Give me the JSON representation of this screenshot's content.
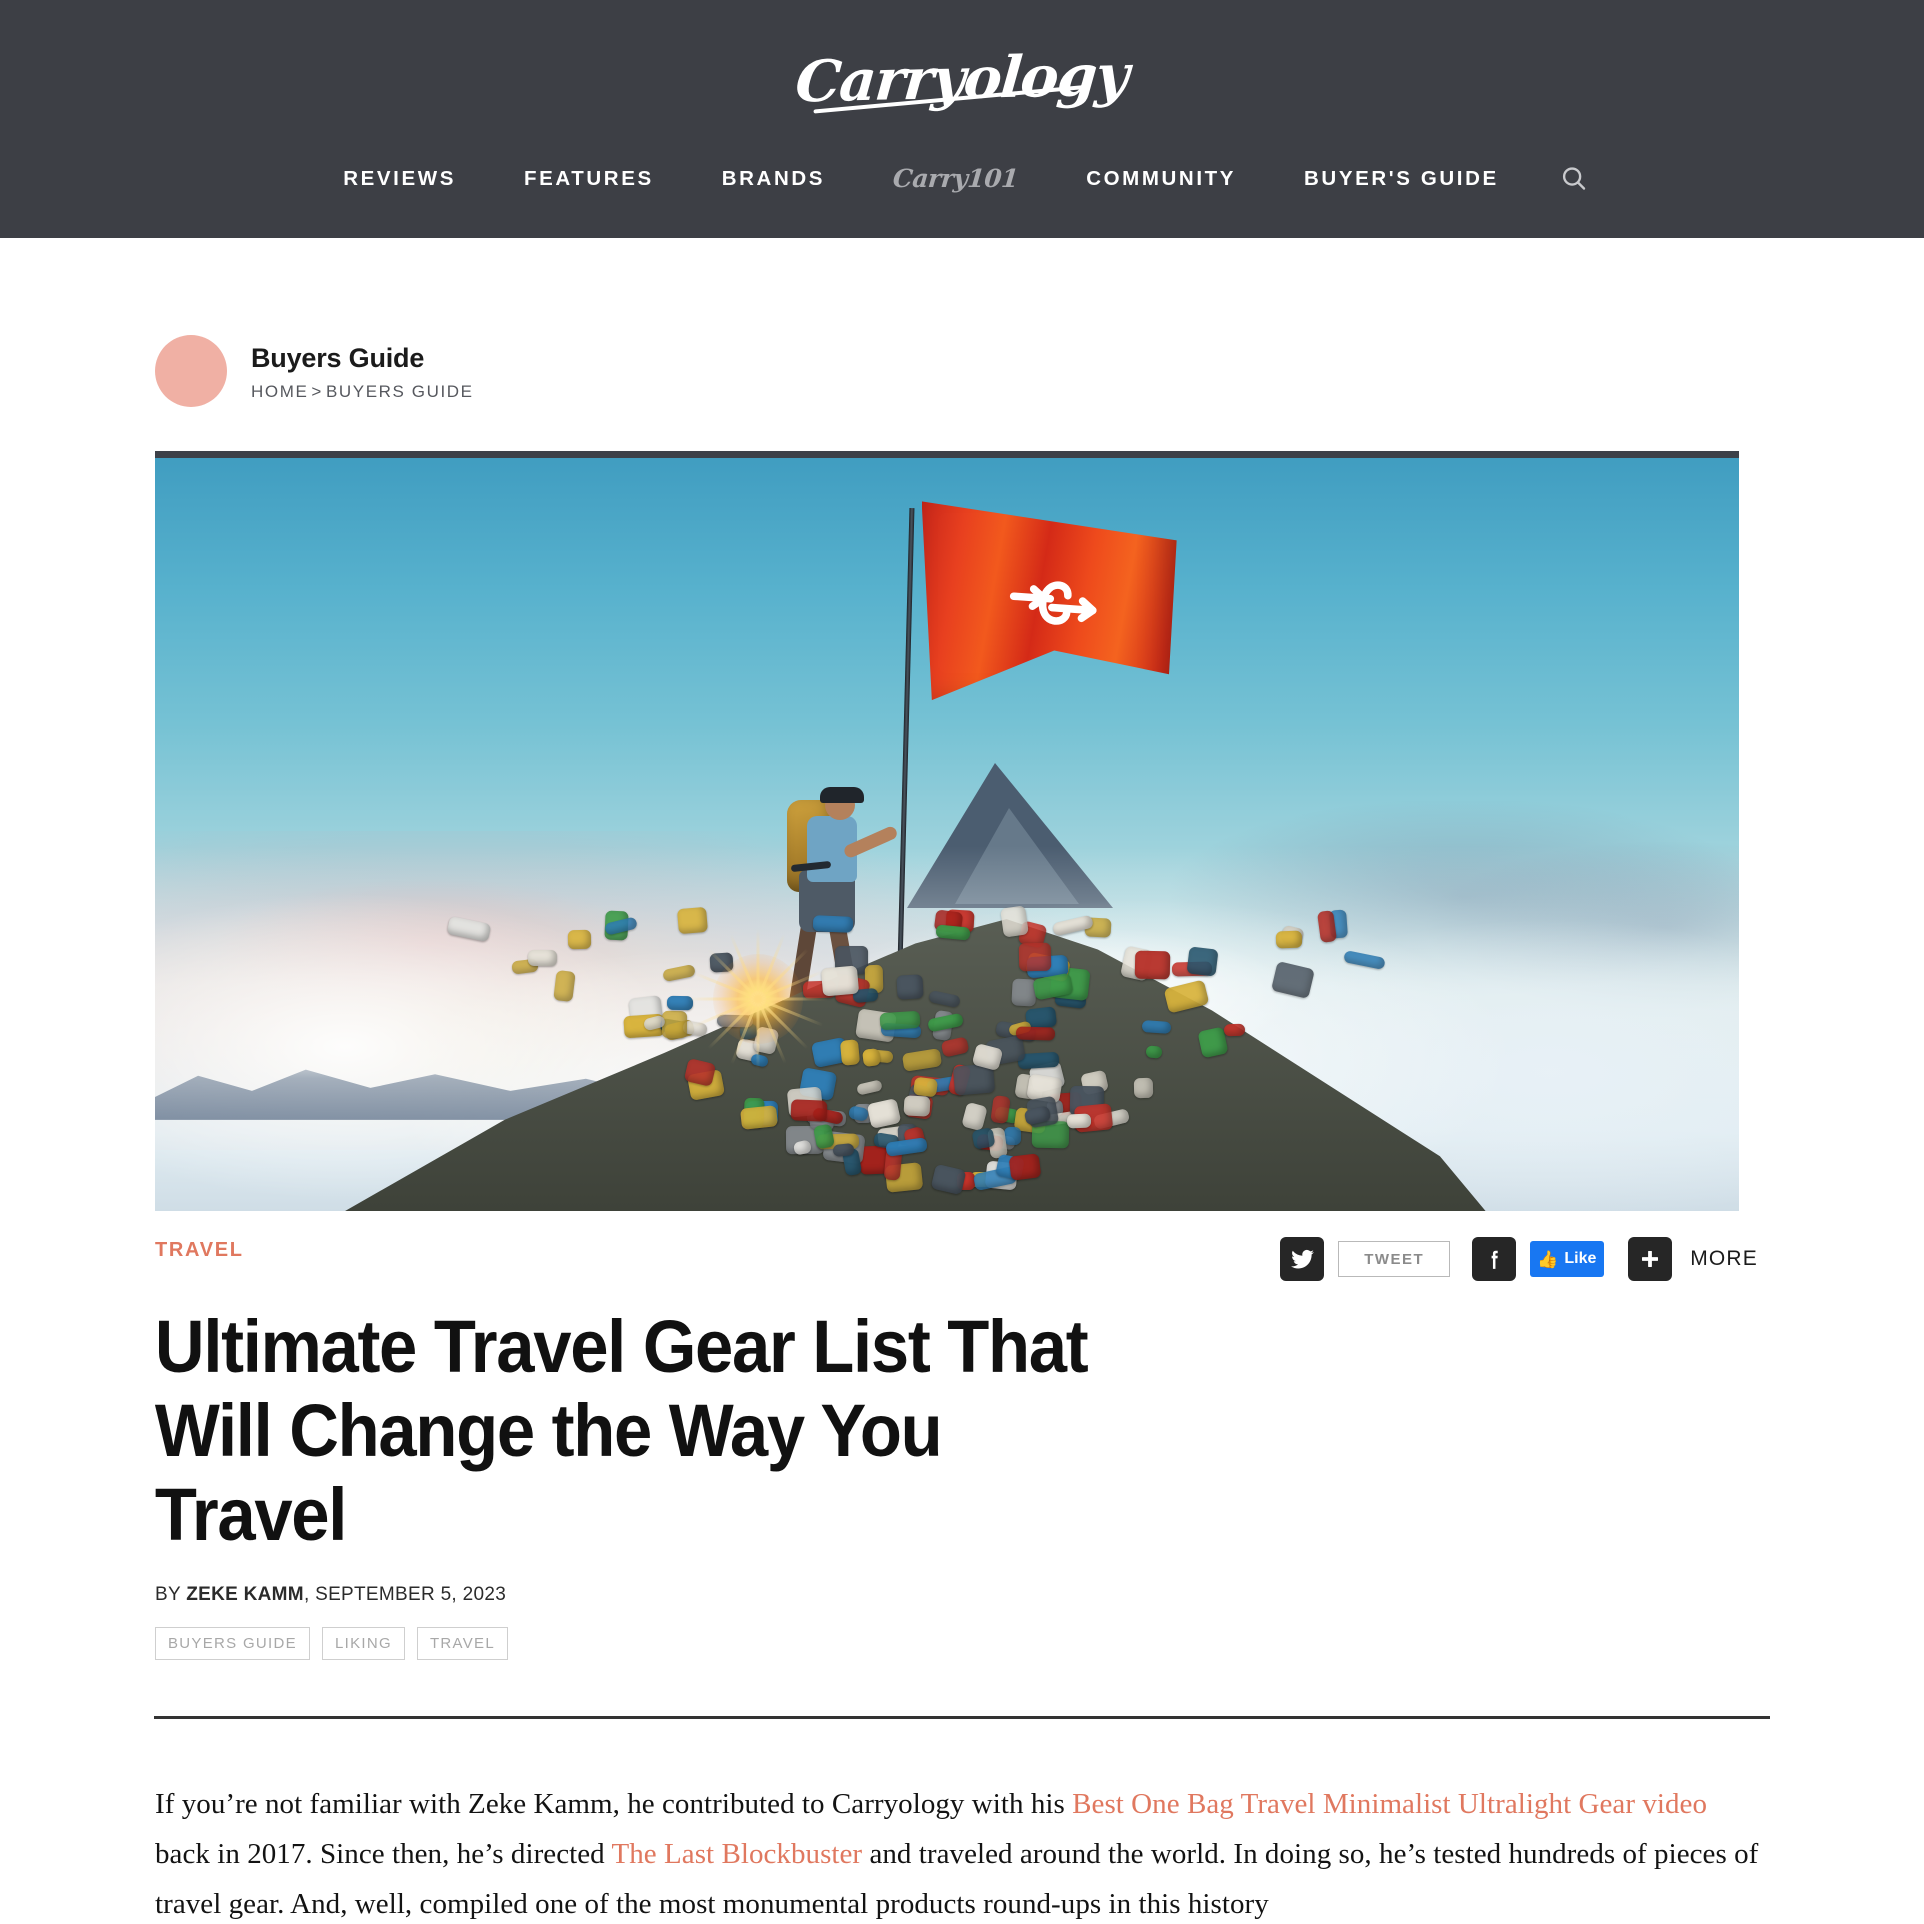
{
  "site": {
    "logo_text": "Carryology",
    "nav": [
      {
        "label": "REVIEWS",
        "style": "caps"
      },
      {
        "label": "FEATURES",
        "style": "caps"
      },
      {
        "label": "BRANDS",
        "style": "caps"
      },
      {
        "label": "Carry101",
        "style": "script"
      },
      {
        "label": "COMMUNITY",
        "style": "caps"
      },
      {
        "label": "BUYER'S GUIDE",
        "style": "caps"
      }
    ],
    "search_icon": "search-icon",
    "header_bg": "#3d3f45"
  },
  "breadcrumb": {
    "section_title": "Buyers Guide",
    "home": "HOME",
    "separator": ">",
    "current": "BUYERS GUIDE",
    "dot_color": "#f0b0a4"
  },
  "hero": {
    "alt": "Hiker standing on a mound of backpacks on a mountain summit holding a red Carryology flag above the clouds at sunset",
    "flag_color": "#e8401f",
    "sky_color": "#57b1cd"
  },
  "article": {
    "kicker": "TRAVEL",
    "kicker_color": "#e0785f",
    "title": "Ultimate Travel Gear List That Will Change the Way You Travel",
    "byline_prefix": "BY ",
    "author": "ZEKE KAMM",
    "byline_suffix": ", SEPTEMBER 5, 2023",
    "tags": [
      "BUYERS GUIDE",
      "LIKING",
      "TRAVEL"
    ],
    "body": {
      "p1_a": "If you’re not familiar with Zeke Kamm, he contributed to Carryology with his ",
      "link1": "Best One Bag Travel Minimalist Ultralight Gear video",
      "p1_b": " back in 2017. Since then, he’s directed ",
      "link2": "The Last Blockbuster",
      "p1_c": " and traveled around the world. In doing so, he’s tested hundreds of pieces of travel gear. And, well, compiled one of the most monumental products round-ups in this history"
    }
  },
  "share": {
    "twitter_icon": "twitter-icon",
    "tweet_label": "TWEET",
    "facebook_icon": "facebook-icon",
    "like_label": "Like",
    "like_color": "#1877f2",
    "plus_icon": "plus-icon",
    "more_label": "MORE"
  }
}
